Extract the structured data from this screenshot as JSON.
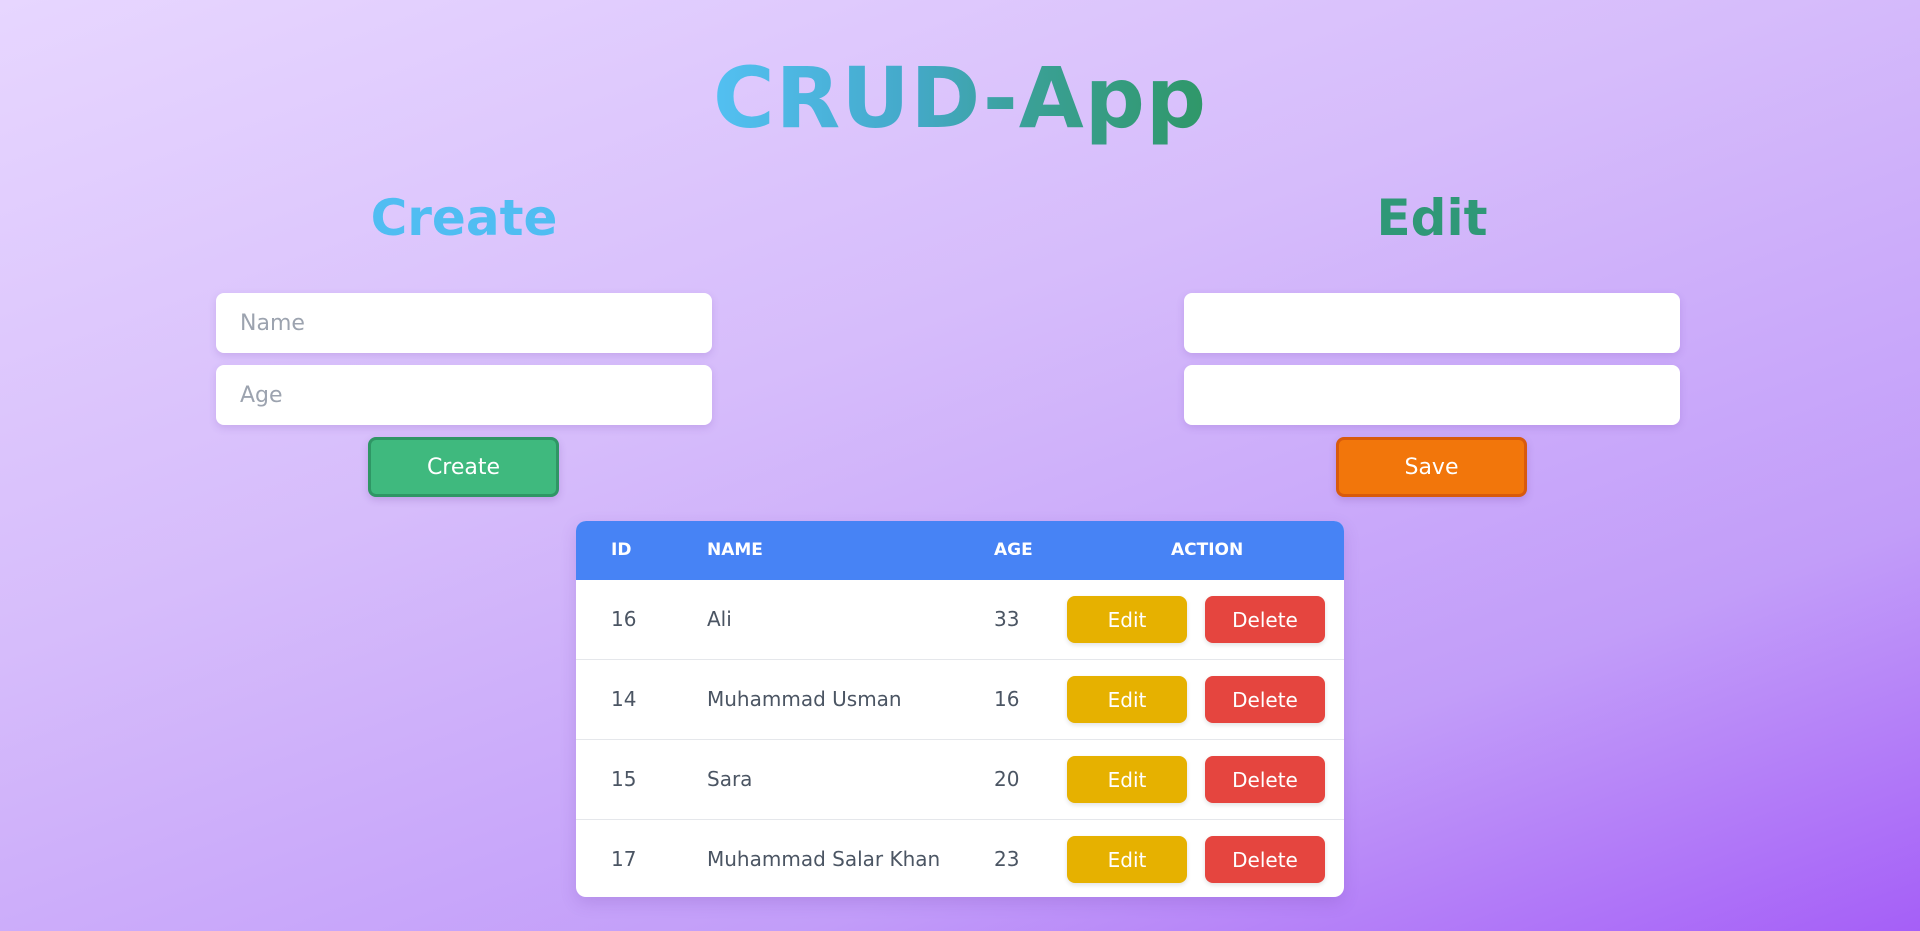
{
  "app": {
    "title": "CRUD-App"
  },
  "create": {
    "heading": "Create",
    "name_placeholder": "Name",
    "age_placeholder": "Age",
    "name_value": "",
    "age_value": "",
    "button_label": "Create"
  },
  "edit": {
    "heading": "Edit",
    "name_placeholder": "",
    "age_placeholder": "",
    "name_value": "",
    "age_value": "",
    "button_label": "Save"
  },
  "table": {
    "headers": {
      "id": "ID",
      "name": "NAME",
      "age": "AGE",
      "action": "ACTION"
    },
    "rows": [
      {
        "id": "16",
        "name": "Ali",
        "age": "33",
        "edit_label": "Edit",
        "delete_label": "Delete"
      },
      {
        "id": "14",
        "name": "Muhammad Usman",
        "age": "16",
        "edit_label": "Edit",
        "delete_label": "Delete"
      },
      {
        "id": "15",
        "name": "Sara",
        "age": "20",
        "edit_label": "Edit",
        "delete_label": "Delete"
      },
      {
        "id": "17",
        "name": "Muhammad Salar Khan",
        "age": "23",
        "edit_label": "Edit",
        "delete_label": "Delete"
      }
    ]
  },
  "colors": {
    "create_button": "#3fb97e",
    "save_button": "#f2760b",
    "table_header": "#4783f5",
    "row_edit_button": "#e6b100",
    "row_delete_button": "#e5453f"
  }
}
